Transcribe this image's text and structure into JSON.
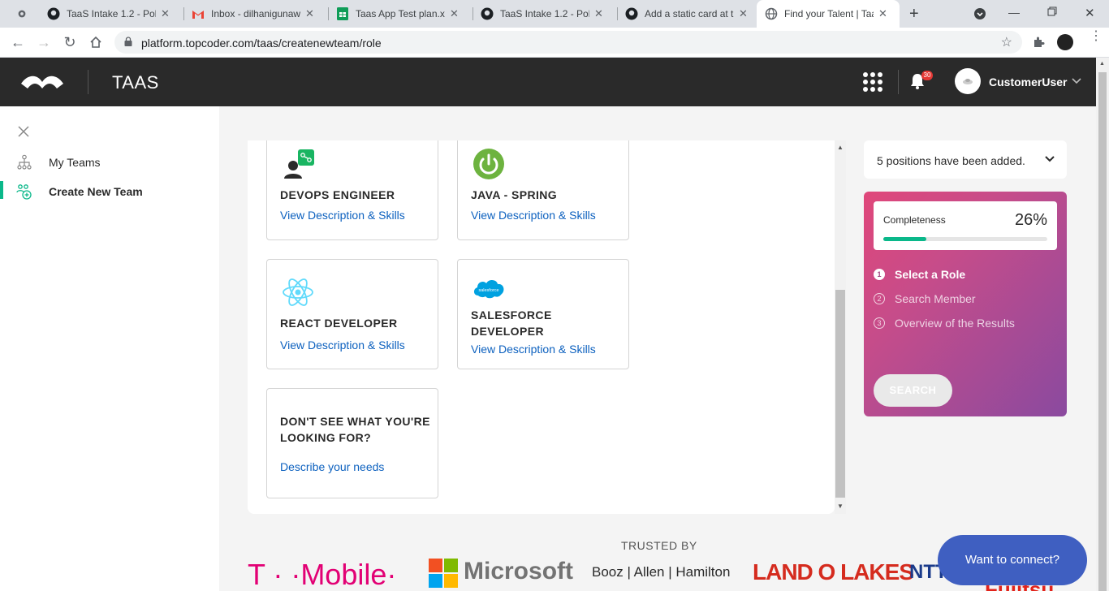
{
  "browser": {
    "tabs": [
      {
        "label": "TaaS Intake 1.2 - Poli",
        "icon": "github-icon",
        "active": false
      },
      {
        "label": "Inbox - dilhanigunaw",
        "icon": "gmail-icon",
        "active": false
      },
      {
        "label": "Taas App Test plan.xls",
        "icon": "sheets-icon",
        "active": false
      },
      {
        "label": "TaaS Intake 1.2 - Poli",
        "icon": "github-icon",
        "active": false
      },
      {
        "label": "Add a static card at th",
        "icon": "github-icon",
        "active": false
      },
      {
        "label": "Find your Talent | Taa",
        "icon": "globe-icon",
        "active": true
      }
    ],
    "url": "platform.topcoder.com/taas/createnewteam/role"
  },
  "header": {
    "brand": "TAAS",
    "notifications_count": "30",
    "username": "CustomerUser"
  },
  "sidebar": {
    "items": [
      {
        "label": "My Teams",
        "icon": "teams-icon",
        "active": false
      },
      {
        "label": "Create New Team",
        "icon": "create-team-icon",
        "active": true
      }
    ]
  },
  "cards": [
    {
      "title": "DEVOPS ENGINEER",
      "link": "View Description & Skills",
      "icon": "devops-icon"
    },
    {
      "title": "JAVA - SPRING",
      "link": "View Description & Skills",
      "icon": "spring-icon"
    },
    {
      "title": "REACT DEVELOPER",
      "link": "View Description & Skills",
      "icon": "react-icon"
    },
    {
      "title": "SALESFORCE DEVELOPER",
      "title_line1": "SALESFORCE",
      "title_line2": "DEVELOPER",
      "link": "View Description & Skills",
      "icon": "salesforce-icon"
    },
    {
      "title_line1": "DON'T SEE WHAT YOU'RE",
      "title_line2": "LOOKING FOR?",
      "link": "Describe your needs"
    }
  ],
  "positions": {
    "text": "5 positions have been added."
  },
  "progress": {
    "label": "Completeness",
    "percent_text": "26%",
    "percent": 26,
    "steps": [
      {
        "num": "1",
        "label": "Select a Role",
        "active": true
      },
      {
        "num": "2",
        "label": "Search Member",
        "active": false
      },
      {
        "num": "3",
        "label": "Overview of the Results",
        "active": false
      }
    ],
    "search_label": "SEARCH"
  },
  "trusted": {
    "heading": "TRUSTED BY",
    "logos": [
      "T · ·Mobile·",
      "Microsoft",
      "Booz | Allen | Hamilton",
      "LAND O LAKES",
      "NTT",
      "Fujitsu"
    ]
  },
  "connect_label": "Want to connect?",
  "colors": {
    "accent": "#0ab88a",
    "link": "#0d61bf",
    "header_bg": "#2a2a2a",
    "connect_bg": "#3f5fc1",
    "tmobile": "#e20074",
    "landolakes": "#d52b1e"
  }
}
